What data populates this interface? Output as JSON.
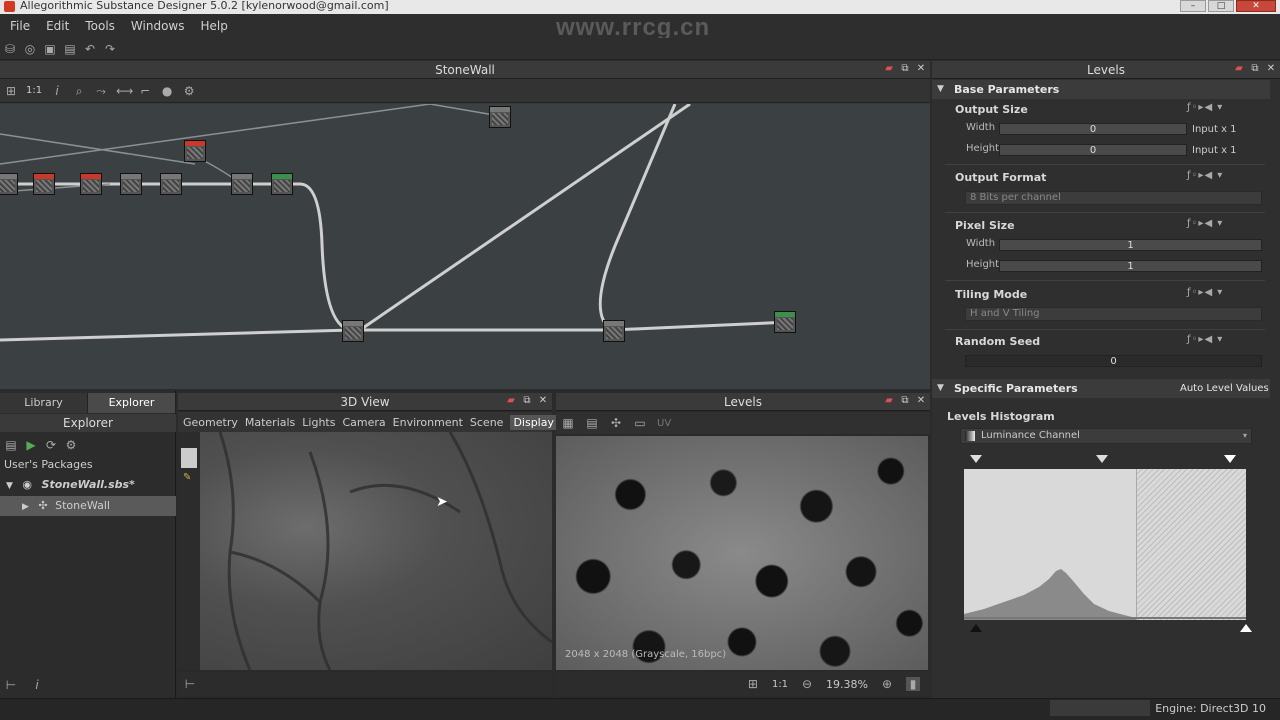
{
  "window": {
    "title": "Allegorithmic Substance Designer 5.0.2 [kylenorwood@gmail.com]"
  },
  "watermark_top": "www.rrcg.cn",
  "menu": [
    "File",
    "Edit",
    "Tools",
    "Windows",
    "Help"
  ],
  "graph": {
    "title": "StoneWall",
    "zoom_label": "1:1"
  },
  "explorer": {
    "tabs": [
      "Library",
      "Explorer"
    ],
    "title": "Explorer",
    "section": "User's Packages",
    "package": "StoneWall.sbs*",
    "graph_item": "StoneWall"
  },
  "view3d": {
    "title": "3D View",
    "menu": [
      "Geometry",
      "Materials",
      "Lights",
      "Camera",
      "Environment",
      "Scene",
      "Display"
    ],
    "active_menu": "Display"
  },
  "view2d": {
    "title": "Levels",
    "uv_label": "UV",
    "info": "2048 x 2048 (Grayscale, 16bpc)",
    "ratio": "1:1",
    "zoom": "19.38%"
  },
  "levels": {
    "title": "Levels",
    "base_params": "Base Parameters",
    "output_size": {
      "label": "Output Size",
      "width_label": "Width",
      "width_value": "0",
      "width_mode": "Input x 1",
      "height_label": "Height",
      "height_value": "0",
      "height_mode": "Input x 1"
    },
    "output_format": {
      "label": "Output Format",
      "value": "8 Bits per channel"
    },
    "pixel_size": {
      "label": "Pixel Size",
      "width_label": "Width",
      "width_value": "1",
      "height_label": "Height",
      "height_value": "1"
    },
    "tiling_mode": {
      "label": "Tiling Mode",
      "value": "H and V Tiling"
    },
    "random_seed": {
      "label": "Random Seed",
      "value": "0"
    },
    "specific_params": "Specific Parameters",
    "auto_level": "Auto Level",
    "values": "Values",
    "histogram_label": "Levels Histogram",
    "channel": "Luminance Channel"
  },
  "status": {
    "engine": "Engine: Direct3D 10"
  },
  "colors": {
    "graph_bg": "#3b4143",
    "node_red": "#c8392c",
    "node_green": "#3d8f4c",
    "pin_red": "#e05050"
  }
}
